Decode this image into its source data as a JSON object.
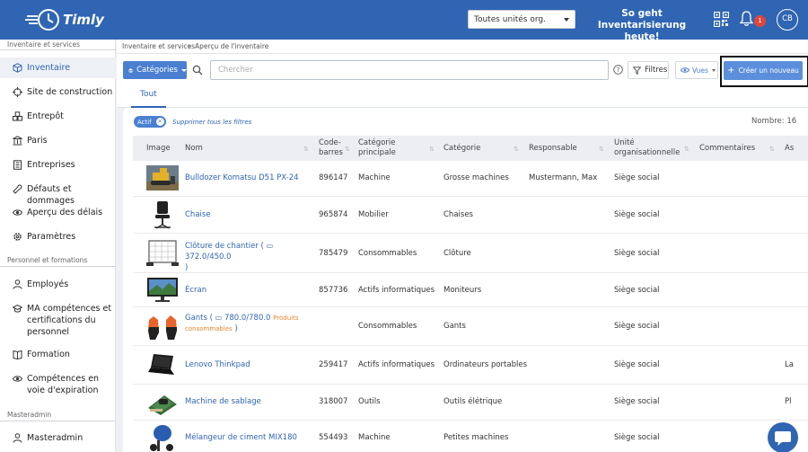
{
  "header": {
    "logo_text": "Timly",
    "org_select": "Toutes unités org.",
    "promo_line1": "So geht",
    "promo_line2": "Inventarisierung heute!",
    "notification_count": "1",
    "avatar_initials": "CB"
  },
  "sidebar": {
    "section1": "Inventaire et services",
    "section2": "Personnel et formations",
    "section3": "Masteradmin",
    "items": [
      {
        "label": "Inventaire",
        "icon": "cube-icon"
      },
      {
        "label": "Site de construction",
        "icon": "crosshair-icon"
      },
      {
        "label": "Entrepôt",
        "icon": "boxes-icon"
      },
      {
        "label": "Paris",
        "icon": "bank-icon"
      },
      {
        "label": "Entreprises",
        "icon": "building-icon"
      },
      {
        "label": "Défauts et dommages",
        "icon": "wrench-icon"
      },
      {
        "label": "Aperçu des délais",
        "icon": "eye-icon"
      },
      {
        "label": "Paramètres",
        "icon": "gear-icon"
      },
      {
        "label": "Employés",
        "icon": "person-icon"
      },
      {
        "label": "MA compétences et certifications du personnel",
        "icon": "graduation-cap-icon"
      },
      {
        "label": "Formation",
        "icon": "book-icon"
      },
      {
        "label": "Compétences en voie d'expiration",
        "icon": "eye-icon"
      },
      {
        "label": "Masteradmin",
        "icon": "person-icon"
      }
    ]
  },
  "breadcrumb": {
    "first": "Inventaire et services",
    "second": "Aperçu de l'inventaire"
  },
  "toolbar": {
    "categories_label": "Catégories",
    "search_placeholder": "Chercher",
    "filters_label": "Filtres",
    "views_label": "Vues",
    "create_label": "Créer un nouveau"
  },
  "tabs": {
    "all": "Tout"
  },
  "filters": {
    "active_chip": "Actif",
    "clear_all": "Supprimer tous les filtres",
    "count": "Nombre: 16"
  },
  "table": {
    "headers": [
      "Image",
      "Nom",
      "Code-barres",
      "Catégorie principale",
      "Catégorie",
      "Responsable",
      "Unité organisationnelle",
      "Commentaires",
      "As"
    ],
    "rows": [
      {
        "name": "Bulldozer Komatsu D51 PX-24",
        "barcode": "896147",
        "main_category": "Machine",
        "category": "Grosse machines",
        "responsible": "Mustermann, Max",
        "org_unit": "Siège social",
        "extra": "",
        "thumb": "bulldozer-image"
      },
      {
        "name": "Chaise",
        "barcode": "965874",
        "main_category": "Mobilier",
        "category": "Chaises",
        "responsible": "",
        "org_unit": "Siège social",
        "extra": "",
        "thumb": "chair-image"
      },
      {
        "name": "Clôture de chantier (",
        "stock": "372.0/450.0",
        "name_end": ")",
        "barcode": "785479",
        "main_category": "Consommables",
        "category": "Clôture",
        "responsible": "",
        "org_unit": "Siège social",
        "extra": "",
        "thumb": "fence-image"
      },
      {
        "name": "Écran",
        "barcode": "857736",
        "main_category": "Actifs informatiques",
        "category": "Moniteurs",
        "responsible": "",
        "org_unit": "Siège social",
        "extra": "",
        "thumb": "monitor-image"
      },
      {
        "name": "Gants (",
        "stock": "780.0/780.0",
        "tag1": "Produits",
        "tag2": "consommables",
        "name_end": ")",
        "barcode": "",
        "main_category": "Consommables",
        "category": "Gants",
        "responsible": "",
        "org_unit": "Siège social",
        "extra": "",
        "thumb": "gloves-image"
      },
      {
        "name": "Lenovo Thinkpad",
        "barcode": "259417",
        "main_category": "Actifs informatiques",
        "category": "Ordinateurs portables",
        "responsible": "",
        "org_unit": "Siège social",
        "extra": "La",
        "thumb": "laptop-image"
      },
      {
        "name": "Machine de sablage",
        "barcode": "318007",
        "main_category": "Outils",
        "category": "Outils élétrique",
        "responsible": "",
        "org_unit": "Siège social",
        "extra": "Pl",
        "thumb": "sander-image"
      },
      {
        "name": "Mélangeur de ciment MIX180",
        "barcode": "554493",
        "main_category": "Machine",
        "category": "Petites machines",
        "responsible": "",
        "org_unit": "Siège social",
        "extra": "",
        "thumb": "mixer-image"
      }
    ]
  },
  "colors": {
    "brand": "#2f65b3",
    "accent": "#4a7fd1",
    "badge": "#e0463c",
    "tag": "#e8862a"
  }
}
